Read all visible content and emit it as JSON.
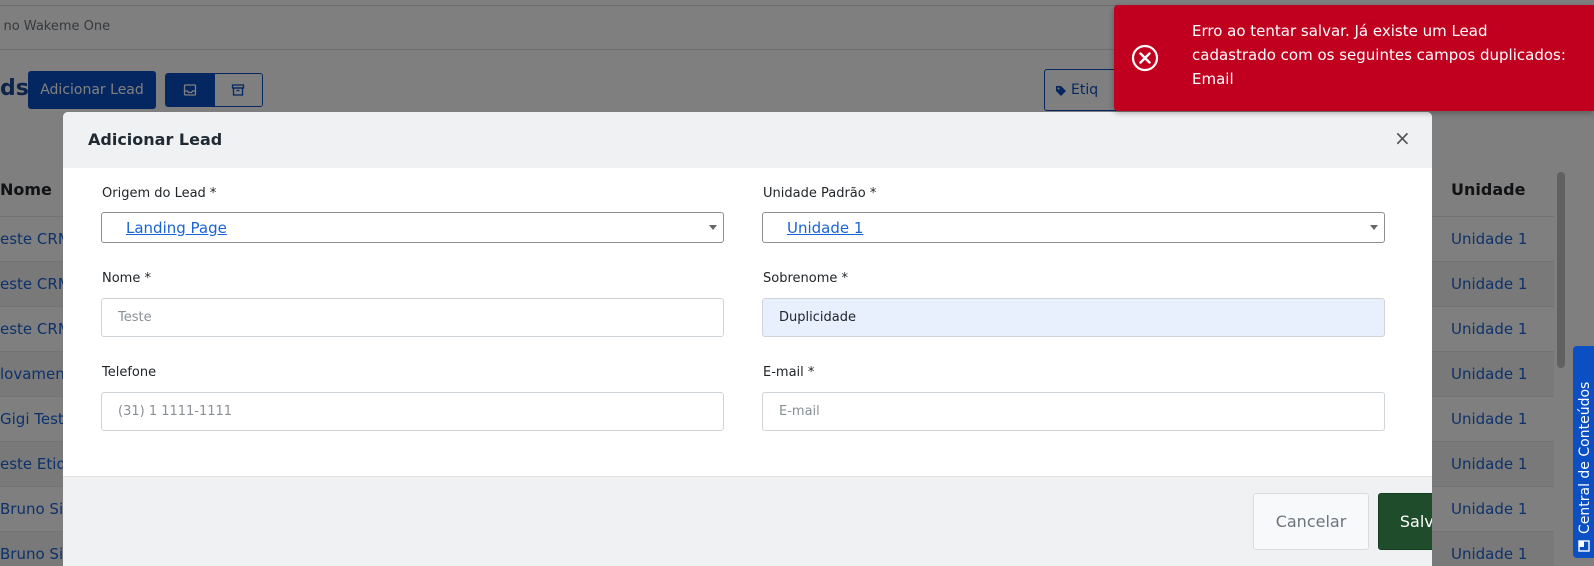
{
  "search": {
    "placeholder_partial": "r no Wakeme One"
  },
  "page": {
    "title_partial": "ds",
    "add_lead_label": "Adicionar Lead",
    "etiq_label_partial": "Etiq"
  },
  "table": {
    "columns": {
      "name": "Nome",
      "unit": "Unidade"
    },
    "rows": [
      {
        "name": "este CRM",
        "unit": "Unidade 1"
      },
      {
        "name": "este CRM",
        "unit": "Unidade 1"
      },
      {
        "name": "este CRM",
        "unit": "Unidade 1"
      },
      {
        "name": "lovamente",
        "unit": "Unidade 1"
      },
      {
        "name": "Gigi Teste",
        "unit": "Unidade 1"
      },
      {
        "name": "este Etiq",
        "unit": "Unidade 1"
      },
      {
        "name": "Bruno Silva",
        "unit": "Unidade 1"
      },
      {
        "name": "Bruno Silva",
        "unit": "Unidade 1"
      }
    ]
  },
  "side_tab": {
    "label": "Central de Conteúdos"
  },
  "modal": {
    "title": "Adicionar Lead",
    "close_symbol": "×",
    "fields": {
      "origem": {
        "label": "Origem do Lead *",
        "value": "Landing Page"
      },
      "unidade": {
        "label": "Unidade Padrão *",
        "value": "Unidade 1"
      },
      "nome": {
        "label": "Nome *",
        "placeholder": "Teste",
        "value": ""
      },
      "sobrenome": {
        "label": "Sobrenome *",
        "value": "Duplicidade"
      },
      "telefone": {
        "label": "Telefone",
        "placeholder": "(31) 1 1111-1111"
      },
      "email": {
        "label": "E-mail *",
        "placeholder": "E-mail"
      }
    },
    "cancel_label": "Cancelar",
    "save_label": "Salvar"
  },
  "toast": {
    "message": "Erro ao tentar salvar. Já existe um Lead cadastrado com os seguintes campos duplicados: Email",
    "color": "#c1001f"
  },
  "colors": {
    "primary": "#0b4fc2",
    "save_button": "#1f4d2c",
    "link": "#1a63d6"
  }
}
